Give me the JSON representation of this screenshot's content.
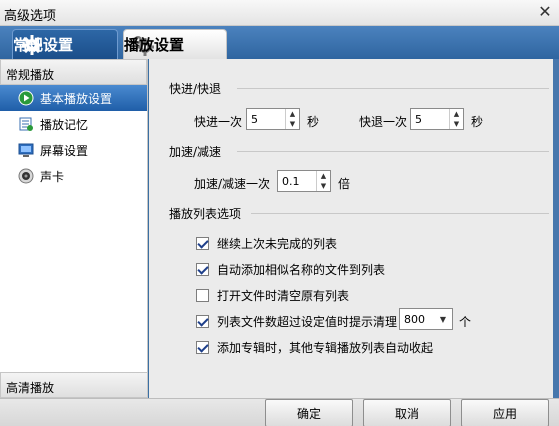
{
  "window": {
    "title": "高级选项",
    "close_glyph": "✕"
  },
  "tabs": [
    {
      "label": "常规设置",
      "icon": "gear-icon"
    },
    {
      "label": "播放设置",
      "icon": "gears-icon"
    }
  ],
  "sidebar": {
    "header": "常规播放",
    "items": [
      {
        "label": "基本播放设置",
        "icon": "play-icon"
      },
      {
        "label": "播放记忆",
        "icon": "bookmark-icon"
      },
      {
        "label": "屏幕设置",
        "icon": "monitor-icon"
      },
      {
        "label": "声卡",
        "icon": "speaker-icon"
      }
    ],
    "footer": "高清播放"
  },
  "sections": {
    "seek": {
      "title": "快进/快退",
      "forward_label": "快进一次",
      "forward_value": "5",
      "forward_unit": "秒",
      "backward_label": "快退一次",
      "backward_value": "5",
      "backward_unit": "秒"
    },
    "speed": {
      "title": "加速/减速",
      "label": "加速/减速一次",
      "value": "0.1",
      "unit": "倍"
    },
    "playlist": {
      "title": "播放列表选项",
      "options": [
        {
          "label": "继续上次未完成的列表",
          "checked": true
        },
        {
          "label": "自动添加相似名称的文件到列表",
          "checked": true
        },
        {
          "label": "打开文件时清空原有列表",
          "checked": false
        },
        {
          "label": "列表文件数超过设定值时提示清理",
          "checked": true
        },
        {
          "label": "添加专辑时，其他专辑播放列表自动收起",
          "checked": true
        }
      ],
      "limit_value": "800",
      "limit_unit": "个"
    }
  },
  "buttons": {
    "ok": "确定",
    "cancel": "取消",
    "apply": "应用"
  },
  "colors": {
    "accent": "#2f65a0",
    "active_item": "#1f5ea8",
    "check": "#1e3f8a"
  }
}
